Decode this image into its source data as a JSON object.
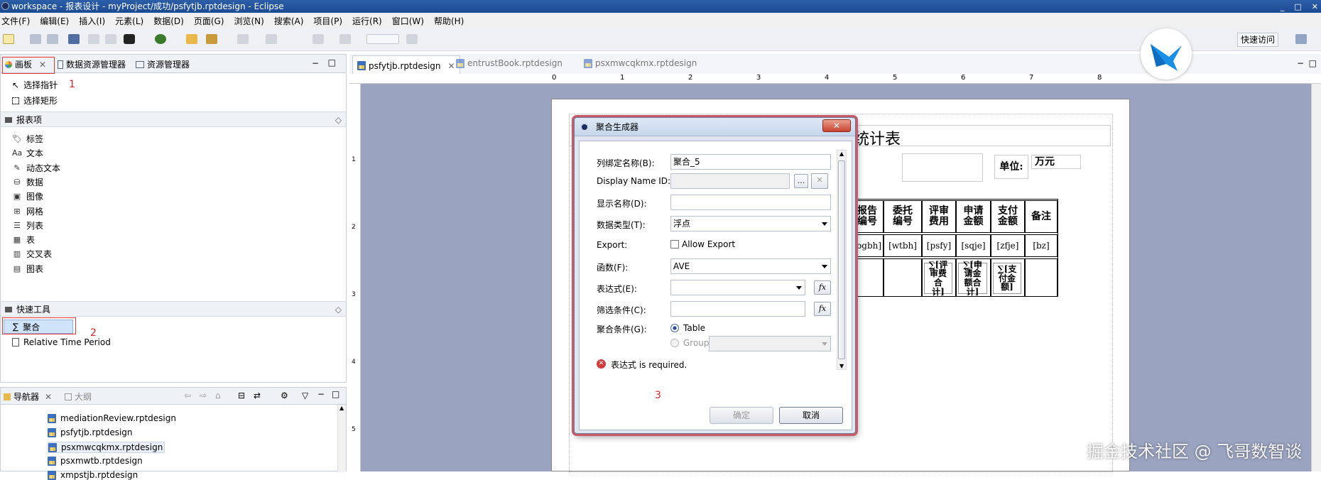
{
  "window": {
    "title": "workspace - 报表设计 - myProject/成功/psfytjb.rptdesign - Eclipse"
  },
  "menubar": {
    "items": [
      "文件(F)",
      "编辑(E)",
      "插入(I)",
      "元素(L)",
      "数据(D)",
      "页面(G)",
      "浏览(N)",
      "搜索(A)",
      "项目(P)",
      "运行(R)",
      "窗口(W)",
      "帮助(H)"
    ]
  },
  "toolbar": {
    "quick_access": "快速访问"
  },
  "left_panel": {
    "tabs": [
      "画板",
      "数据资源管理器",
      "资源管理器"
    ],
    "tools": [
      "选择指针",
      "选择矩形"
    ],
    "annotation_1": "1",
    "report_items_header": "报表项",
    "report_items": [
      "标签",
      "文本",
      "动态文本",
      "数据",
      "图像",
      "网格",
      "列表",
      "表",
      "交叉表",
      "图表"
    ],
    "quick_tools_header": "快速工具",
    "quick_tools": [
      "聚合",
      "Relative Time Period"
    ],
    "annotation_2": "2"
  },
  "navigator": {
    "tabs": [
      "导航器",
      "大纲"
    ],
    "files": [
      "mediationReview.rptdesign",
      "psfytjb.rptdesign",
      "psxmwcqkmx.rptdesign",
      "psxmwtb.rptdesign",
      "xmpstjb.rptdesign"
    ]
  },
  "editor": {
    "tabs": [
      "psfytjb.rptdesign",
      "entrustBook.rptdesign",
      "psxmwcqkmx.rptdesign"
    ],
    "ruler_marks": [
      "0",
      "1",
      "2",
      "3",
      "4",
      "5",
      "6",
      "7",
      "8"
    ],
    "vruler_marks": [
      "1",
      "2",
      "3",
      "4",
      "5"
    ]
  },
  "report": {
    "title_fragment": "统计表",
    "unit_label": "单位:",
    "unit_value": "万元",
    "headers": [
      "报告编号",
      "委托编号",
      "评审费用",
      "申请金额",
      "支付金额",
      "备注"
    ],
    "bindings": [
      "[bgbh]",
      "[wtbh]",
      "[psfy]",
      "[sqje]",
      "[zfje]",
      "[bz]"
    ],
    "aggregates": [
      "∑[评审费合计]",
      "∑[申请金额合计]",
      "∑[支付金额]"
    ]
  },
  "dialog": {
    "title": "聚合生成器",
    "fields": {
      "column_binding_label": "列绑定名称(B):",
      "column_binding_value": "聚合_5",
      "display_name_id_label": "Display Name ID:",
      "display_name_label": "显示名称(D):",
      "display_name_value": "",
      "data_type_label": "数据类型(T):",
      "data_type_value": "浮点",
      "export_label": "Export:",
      "allow_export_label": "Allow Export",
      "function_label": "函数(F):",
      "function_value": "AVE",
      "expression_label": "表达式(E):",
      "filter_label": "筛选条件(C):",
      "aggregate_on_label": "聚合条件(G):",
      "radio_table": "Table",
      "radio_group": "Group"
    },
    "error": "表达式 is required.",
    "annotation_3": "3",
    "ok_label": "确定",
    "cancel_label": "取消",
    "ellipsis": "...",
    "fx": "fx"
  },
  "watermark": "掘金技术社区 @ 飞哥数智谈",
  "colors": {
    "canvas": "#9aa3c0",
    "annotation_red": "#dd2222",
    "dialog_border": "#c85a6a"
  }
}
